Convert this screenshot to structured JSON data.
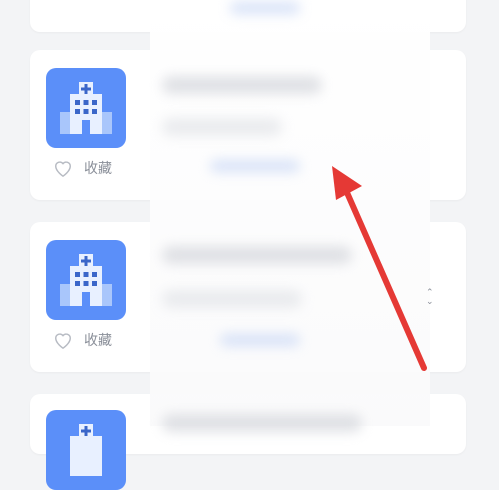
{
  "cards": [
    {
      "id": "top",
      "favorite_label": ""
    },
    {
      "id": "card-1",
      "favorite_label": "收藏"
    },
    {
      "id": "card-2",
      "favorite_label": "收藏"
    },
    {
      "id": "card-3",
      "favorite_label": ""
    }
  ],
  "side_mark": "⌃\n⌄",
  "icons": {
    "hospital": "hospital-building-icon",
    "favorite": "heart-outline-icon",
    "annotation": "red-arrow"
  },
  "colors": {
    "icon_bg": "#5b8ff9",
    "arrow": "#e53935",
    "muted_text": "#8a8f99",
    "page_bg": "#f3f4f6"
  }
}
